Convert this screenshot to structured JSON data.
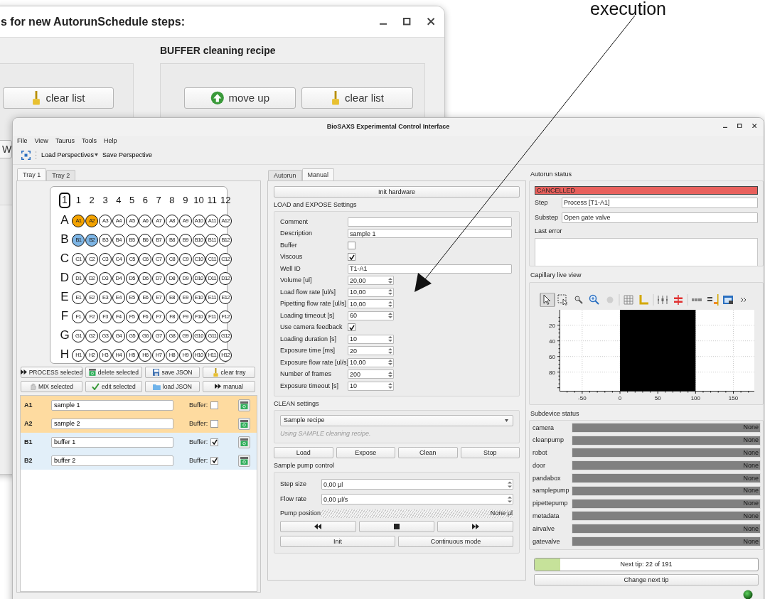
{
  "annotation": {
    "text": "execution"
  },
  "background_window": {
    "title": "s for new AutorunSchedule steps:",
    "groups": [
      {
        "buttons": [
          {
            "label": "clear list"
          }
        ]
      },
      {
        "title": "BUFFER cleaning recipe",
        "buttons": [
          {
            "label": "move up"
          },
          {
            "label": "clear list"
          }
        ]
      }
    ],
    "partial_button": "W"
  },
  "window": {
    "title": "BioSAXS Experimental Control Interface"
  },
  "menu": [
    "File",
    "View",
    "Taurus",
    "Tools",
    "Help"
  ],
  "toolbar": [
    "Load Perspectives",
    "Save Perspective"
  ],
  "tray_tabs": [
    {
      "label": "Tray 1",
      "selected": true
    },
    {
      "label": "Tray 2",
      "selected": false
    }
  ],
  "plate": {
    "tray": "1",
    "columns": [
      "1",
      "2",
      "3",
      "4",
      "5",
      "6",
      "7",
      "8",
      "9",
      "10",
      "11",
      "12"
    ],
    "rows": [
      {
        "label": "A",
        "wells": [
          {
            "label": "A1",
            "color": "#f4a300"
          },
          {
            "label": "A2",
            "color": "#f4a300"
          },
          {
            "label": "A3",
            "color": "#ffffff"
          },
          {
            "label": "A4",
            "color": "#ffffff"
          },
          {
            "label": "A5",
            "color": "#ffffff"
          },
          {
            "label": "A6",
            "color": "#ffffff"
          },
          {
            "label": "A7",
            "color": "#ffffff"
          },
          {
            "label": "A8",
            "color": "#ffffff"
          },
          {
            "label": "A9",
            "color": "#ffffff"
          },
          {
            "label": "A10",
            "color": "#ffffff"
          },
          {
            "label": "A11",
            "color": "#ffffff"
          },
          {
            "label": "A12",
            "color": "#ffffff"
          }
        ]
      },
      {
        "label": "B",
        "wells": [
          {
            "label": "B1",
            "color": "#7db5e5"
          },
          {
            "label": "B2",
            "color": "#7db5e5"
          },
          {
            "label": "B3",
            "color": "#ffffff"
          },
          {
            "label": "B4",
            "color": "#ffffff"
          },
          {
            "label": "B5",
            "color": "#ffffff"
          },
          {
            "label": "B6",
            "color": "#ffffff"
          },
          {
            "label": "B7",
            "color": "#ffffff"
          },
          {
            "label": "B8",
            "color": "#ffffff"
          },
          {
            "label": "B9",
            "color": "#ffffff"
          },
          {
            "label": "B10",
            "color": "#ffffff"
          },
          {
            "label": "B11",
            "color": "#ffffff"
          },
          {
            "label": "B12",
            "color": "#ffffff"
          }
        ]
      },
      {
        "label": "C",
        "wells": [
          {
            "label": "C1",
            "color": "#ffffff"
          },
          {
            "label": "C2",
            "color": "#ffffff"
          },
          {
            "label": "C3",
            "color": "#ffffff"
          },
          {
            "label": "C4",
            "color": "#ffffff"
          },
          {
            "label": "C5",
            "color": "#ffffff"
          },
          {
            "label": "C6",
            "color": "#ffffff"
          },
          {
            "label": "C7",
            "color": "#ffffff"
          },
          {
            "label": "C8",
            "color": "#ffffff"
          },
          {
            "label": "C9",
            "color": "#ffffff"
          },
          {
            "label": "C10",
            "color": "#ffffff"
          },
          {
            "label": "C11",
            "color": "#ffffff"
          },
          {
            "label": "C12",
            "color": "#ffffff"
          }
        ]
      },
      {
        "label": "D",
        "wells": [
          {
            "label": "D1",
            "color": "#ffffff"
          },
          {
            "label": "D2",
            "color": "#ffffff"
          },
          {
            "label": "D3",
            "color": "#ffffff"
          },
          {
            "label": "D4",
            "color": "#ffffff"
          },
          {
            "label": "D5",
            "color": "#ffffff"
          },
          {
            "label": "D6",
            "color": "#ffffff"
          },
          {
            "label": "D7",
            "color": "#ffffff"
          },
          {
            "label": "D8",
            "color": "#ffffff"
          },
          {
            "label": "D9",
            "color": "#ffffff"
          },
          {
            "label": "D10",
            "color": "#ffffff"
          },
          {
            "label": "D11",
            "color": "#ffffff"
          },
          {
            "label": "D12",
            "color": "#ffffff"
          }
        ]
      },
      {
        "label": "E",
        "wells": [
          {
            "label": "E1",
            "color": "#ffffff"
          },
          {
            "label": "E2",
            "color": "#ffffff"
          },
          {
            "label": "E3",
            "color": "#ffffff"
          },
          {
            "label": "E4",
            "color": "#ffffff"
          },
          {
            "label": "E5",
            "color": "#ffffff"
          },
          {
            "label": "E6",
            "color": "#ffffff"
          },
          {
            "label": "E7",
            "color": "#ffffff"
          },
          {
            "label": "E8",
            "color": "#ffffff"
          },
          {
            "label": "E9",
            "color": "#ffffff"
          },
          {
            "label": "E10",
            "color": "#ffffff"
          },
          {
            "label": "E11",
            "color": "#ffffff"
          },
          {
            "label": "E12",
            "color": "#ffffff"
          }
        ]
      },
      {
        "label": "F",
        "wells": [
          {
            "label": "F1",
            "color": "#ffffff"
          },
          {
            "label": "F2",
            "color": "#ffffff"
          },
          {
            "label": "F3",
            "color": "#ffffff"
          },
          {
            "label": "F4",
            "color": "#ffffff"
          },
          {
            "label": "F5",
            "color": "#ffffff"
          },
          {
            "label": "F6",
            "color": "#ffffff"
          },
          {
            "label": "F7",
            "color": "#ffffff"
          },
          {
            "label": "F8",
            "color": "#ffffff"
          },
          {
            "label": "F9",
            "color": "#ffffff"
          },
          {
            "label": "F10",
            "color": "#ffffff"
          },
          {
            "label": "F11",
            "color": "#ffffff"
          },
          {
            "label": "F12",
            "color": "#ffffff"
          }
        ]
      },
      {
        "label": "G",
        "wells": [
          {
            "label": "G1",
            "color": "#ffffff"
          },
          {
            "label": "G2",
            "color": "#ffffff"
          },
          {
            "label": "G3",
            "color": "#ffffff"
          },
          {
            "label": "G4",
            "color": "#ffffff"
          },
          {
            "label": "G5",
            "color": "#ffffff"
          },
          {
            "label": "G6",
            "color": "#ffffff"
          },
          {
            "label": "G7",
            "color": "#ffffff"
          },
          {
            "label": "G8",
            "color": "#ffffff"
          },
          {
            "label": "G9",
            "color": "#ffffff"
          },
          {
            "label": "G10",
            "color": "#ffffff"
          },
          {
            "label": "G11",
            "color": "#ffffff"
          },
          {
            "label": "G12",
            "color": "#ffffff"
          }
        ]
      },
      {
        "label": "H",
        "wells": [
          {
            "label": "H1",
            "color": "#ffffff"
          },
          {
            "label": "H2",
            "color": "#ffffff"
          },
          {
            "label": "H3",
            "color": "#ffffff"
          },
          {
            "label": "H4",
            "color": "#ffffff"
          },
          {
            "label": "H5",
            "color": "#ffffff"
          },
          {
            "label": "H6",
            "color": "#ffffff"
          },
          {
            "label": "H7",
            "color": "#ffffff"
          },
          {
            "label": "H8",
            "color": "#ffffff"
          },
          {
            "label": "H9",
            "color": "#ffffff"
          },
          {
            "label": "H10",
            "color": "#ffffff"
          },
          {
            "label": "H11",
            "color": "#ffffff"
          },
          {
            "label": "H12",
            "color": "#ffffff"
          }
        ]
      }
    ]
  },
  "tray_buttons": [
    "PROCESS selected",
    "delete selected",
    "save JSON",
    "clear tray",
    "MIX selected",
    "edit selected",
    "load JSON",
    "manual"
  ],
  "samples": [
    {
      "well": "A1",
      "name": "sample 1",
      "buffer_label": "Buffer:",
      "buffer": false,
      "color": "#fedba0"
    },
    {
      "well": "A2",
      "name": "sample 2",
      "buffer_label": "Buffer:",
      "buffer": false,
      "color": "#fedba0"
    },
    {
      "well": "B1",
      "name": "buffer 1",
      "buffer_label": "Buffer:",
      "buffer": true,
      "color": "#e2eff9"
    },
    {
      "well": "B2",
      "name": "buffer 2",
      "buffer_label": "Buffer:",
      "buffer": true,
      "color": "#e2eff9"
    }
  ],
  "mode_tabs": [
    {
      "label": "Autorun",
      "selected": false
    },
    {
      "label": "Manual",
      "selected": true
    }
  ],
  "init_button": "Init hardware",
  "load_expose": {
    "title": "LOAD and EXPOSE Settings",
    "fields": [
      {
        "label": "Comment",
        "kind": "text"
      },
      {
        "label": "Description",
        "kind": "text",
        "value": "sample 1"
      },
      {
        "label": "Buffer",
        "kind": "check",
        "checked": false
      },
      {
        "label": "Viscous",
        "kind": "check",
        "checked": true
      },
      {
        "label": "Well ID",
        "kind": "text",
        "value": "T1-A1"
      },
      {
        "label": "Volume [ul]",
        "kind": "spin",
        "value": "20,00"
      },
      {
        "label": "Load flow rate [ul/s]",
        "kind": "spin",
        "value": "10,00"
      },
      {
        "label": "Pipetting flow rate [ul/s]",
        "kind": "spin",
        "value": "10,00"
      },
      {
        "label": "Loading timeout [s]",
        "kind": "spin",
        "value": "60"
      },
      {
        "label": "Use camera feedback",
        "kind": "check",
        "checked": true
      },
      {
        "label": "Loading duration [s]",
        "kind": "spin",
        "value": "10"
      },
      {
        "label": "Exposure time [ms]",
        "kind": "spin",
        "value": "20"
      },
      {
        "label": "Exposure flow rate [ul/s]",
        "kind": "spin",
        "value": "10,00"
      },
      {
        "label": "Number of frames",
        "kind": "spin",
        "value": "200"
      },
      {
        "label": "Exposure timeout [s]",
        "kind": "spin",
        "value": "10"
      }
    ]
  },
  "clean": {
    "title": "CLEAN settings",
    "recipe": "Sample recipe",
    "hint": "Using SAMPLE cleaning recipe."
  },
  "actions": [
    "Load",
    "Expose",
    "Clean",
    "Stop"
  ],
  "pump": {
    "title": "Sample pump control",
    "fields": [
      {
        "label": "Step size",
        "value": "0,00 µl"
      },
      {
        "label": "Flow rate",
        "value": "0,00 µl/s"
      }
    ],
    "position_label": "Pump position",
    "position_value": "None µl",
    "buttons": [
      "Init",
      "Continuous mode"
    ]
  },
  "autorun_status": {
    "title": "Autorun status",
    "state": "CANCELLED",
    "fields": [
      {
        "label": "Step",
        "value": "Process [T1-A1]"
      },
      {
        "label": "Substep",
        "value": "Open gate valve"
      }
    ],
    "error_label": "Last error"
  },
  "live_view": {
    "title": "Capillary live view",
    "tools": [
      {
        "selected": true
      },
      {
        "selected": false
      },
      {
        "selected": false
      },
      {
        "selected": false
      },
      {
        "selected": false
      },
      {
        "selected": false
      },
      {
        "selected": false
      },
      {
        "selected": false
      },
      {
        "selected": false
      },
      {
        "selected": false
      },
      {
        "selected": false
      },
      {
        "selected": false
      },
      {
        "selected": false
      }
    ],
    "xticks": [
      "-50",
      "0",
      "50",
      "100",
      "150"
    ],
    "yticks": [
      "20",
      "40",
      "60",
      "80"
    ]
  },
  "subdevices": {
    "title": "Subdevice status",
    "items": [
      {
        "name": "camera",
        "value": "None"
      },
      {
        "name": "cleanpump",
        "value": "None"
      },
      {
        "name": "robot",
        "value": "None"
      },
      {
        "name": "door",
        "value": "None"
      },
      {
        "name": "pandabox",
        "value": "None"
      },
      {
        "name": "samplepump",
        "value": "None"
      },
      {
        "name": "pipettepump",
        "value": "None"
      },
      {
        "name": "metadata",
        "value": "None"
      },
      {
        "name": "airvalve",
        "value": "None"
      },
      {
        "name": "gatevalve",
        "value": "None"
      }
    ]
  },
  "next_tip": {
    "label": "Next tip: 22 of 191",
    "level": 0.115
  },
  "change_tip": "Change next tip",
  "connection": {
    "on": true
  }
}
